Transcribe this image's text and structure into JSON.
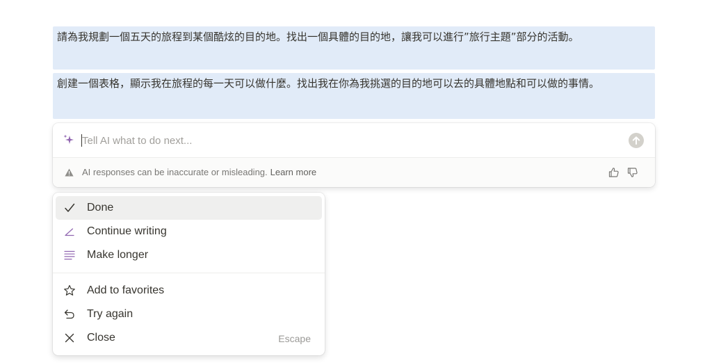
{
  "document": {
    "paragraphs": [
      "請為我規劃一個五天的旅程到某個酷炫的目的地。找出一個具體的目的地，讓我可以進行”旅行主題”部分的活動。",
      "創建一個表格，顯示我在旅程的每一天可以做什麼。找出我在你為我挑選的目的地可以去的具體地點和可以做的事情。"
    ]
  },
  "ai_panel": {
    "input_placeholder": "Tell AI what to do next...",
    "input_value": "",
    "disclaimer": "AI responses can be inaccurate or misleading.",
    "learn_more": "Learn more",
    "accent_color": "#9065b0"
  },
  "menu": {
    "items": [
      {
        "label": "Done",
        "icon": "checkmark-icon"
      },
      {
        "label": "Continue writing",
        "icon": "pen-icon"
      },
      {
        "label": "Make longer",
        "icon": "lines-icon"
      },
      {
        "label": "Add to favorites",
        "icon": "star-icon"
      },
      {
        "label": "Try again",
        "icon": "undo-icon"
      },
      {
        "label": "Close",
        "icon": "close-icon",
        "shortcut": "Escape"
      }
    ]
  }
}
